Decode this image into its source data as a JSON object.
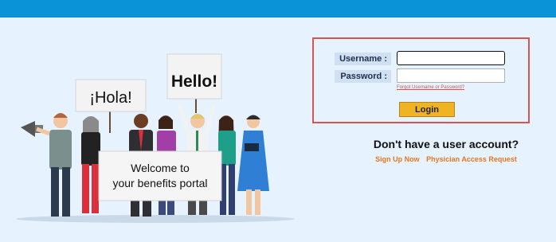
{
  "colors": {
    "topbar": "#0a93d6",
    "page_bg": "#e6f2fd",
    "login_border": "#d9534f",
    "login_button": "#f0b323",
    "link": "#e87722"
  },
  "illustration": {
    "sign_hola": "¡Hola!",
    "sign_hello": "Hello!",
    "banner_line1": "Welcome to",
    "banner_line2": "your benefits portal"
  },
  "login": {
    "username_label": "Username :",
    "password_label": "Password :",
    "username_value": "",
    "password_value": "",
    "forgot_link": "Forgot Username or Password?",
    "login_button": "Login"
  },
  "signup": {
    "heading": "Don't have a user account?",
    "sign_up_link": "Sign Up Now",
    "physician_link": "Physician Access Request"
  }
}
